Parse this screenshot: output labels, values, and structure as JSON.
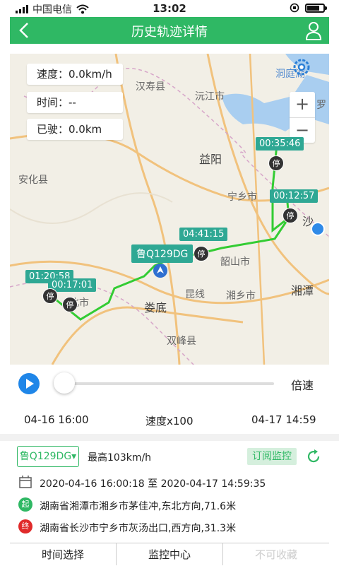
{
  "status_bar": {
    "carrier": "中国电信",
    "time": "13:02"
  },
  "header": {
    "title": "历史轨迹详情"
  },
  "map": {
    "speed": "速度：0.0km/h",
    "time": "时间：--",
    "traveled": "已驶：0.0km",
    "places": [
      "汉寿县",
      "沅江市",
      "洞庭湖",
      "罗",
      "益阳",
      "安化县",
      "宁乡市",
      "沙",
      "韶山市",
      "湘乡市",
      "湘潭",
      "娄底",
      "双峰县",
      "北市",
      "昆线"
    ],
    "time_labels": [
      "00:35:46",
      "00:12:57",
      "04:41:15",
      "01:20:58",
      "00:17:01"
    ],
    "stop_label": "停",
    "plate": "鲁Q129DG",
    "zoom_in": "+",
    "zoom_out": "−"
  },
  "player": {
    "speed_label": "倍速",
    "progress": 0
  },
  "timeline": {
    "start": "04-16 16:00",
    "speed": "速度x100",
    "end": "04-17 14:59"
  },
  "vehicle": {
    "plate_select": "鲁Q129DG▾",
    "max_speed": "最高103km/h",
    "subscribe": "订阅监控",
    "date_range": "2020-04-16 16:00:18 至 2020-04-17 14:59:35",
    "start_badge": "起",
    "start_location": "湖南省湘潭市湘乡市茅佳冲,东北方向,71.6米",
    "end_badge": "终",
    "end_location": "湖南省长沙市宁乡市灰汤出口,西方向,31.3米"
  },
  "tabs": [
    "时间选择",
    "监控中心",
    "不可收藏"
  ],
  "colors": {
    "brand_green": "#2fb864",
    "track_green": "#33cc33",
    "label_teal": "#2fa894",
    "play_blue": "#1f86e8"
  }
}
